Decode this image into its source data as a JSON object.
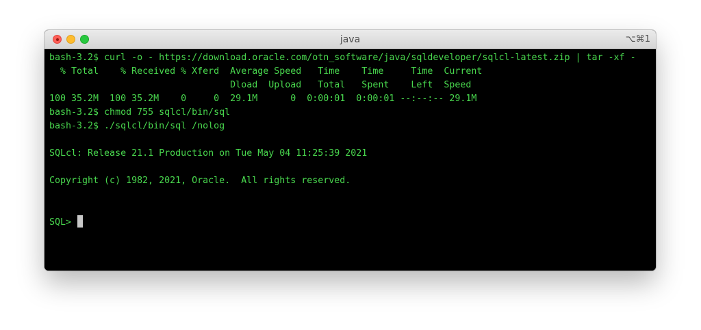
{
  "window": {
    "title": "java",
    "shortcut": "⌥⌘1"
  },
  "terminal": {
    "lines": [
      "bash-3.2$ curl -o - https://download.oracle.com/otn_software/java/sqldeveloper/sqlcl-latest.zip | tar -xf -",
      "  % Total    % Received % Xferd  Average Speed   Time    Time     Time  Current",
      "                                 Dload  Upload   Total   Spent    Left  Speed",
      "100 35.2M  100 35.2M    0     0  29.1M      0  0:00:01  0:00:01 --:--:-- 29.1M",
      "bash-3.2$ chmod 755 sqlcl/bin/sql",
      "bash-3.2$ ./sqlcl/bin/sql /nolog",
      "",
      "SQLcl: Release 21.1 Production on Tue May 04 11:25:39 2021",
      "",
      "Copyright (c) 1982, 2021, Oracle.  All rights reserved.",
      "",
      "",
      "SQL> "
    ]
  },
  "colors": {
    "text": "#49d84e",
    "background": "#000000",
    "cursor": "#c8c8c8"
  }
}
